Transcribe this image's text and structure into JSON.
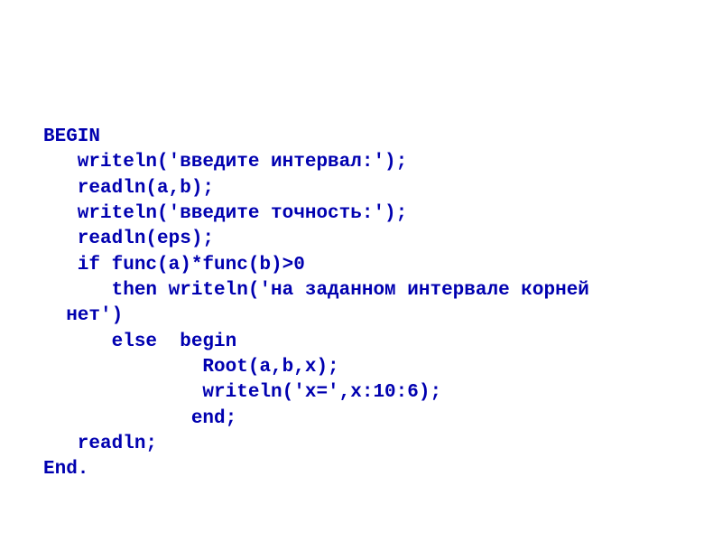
{
  "code": {
    "lines": [
      "BEGIN",
      "   writeln('введите интервал:');",
      "   readln(a,b);",
      "   writeln('введите точность:');",
      "   readln(eps);",
      "   if func(a)*func(b)>0",
      "      then writeln('на заданном интервале корней",
      "  нет')",
      "      else  begin",
      "              Root(a,b,x);",
      "              writeln('x=',x:10:6);",
      "             end;",
      "   readln;",
      "End."
    ]
  }
}
